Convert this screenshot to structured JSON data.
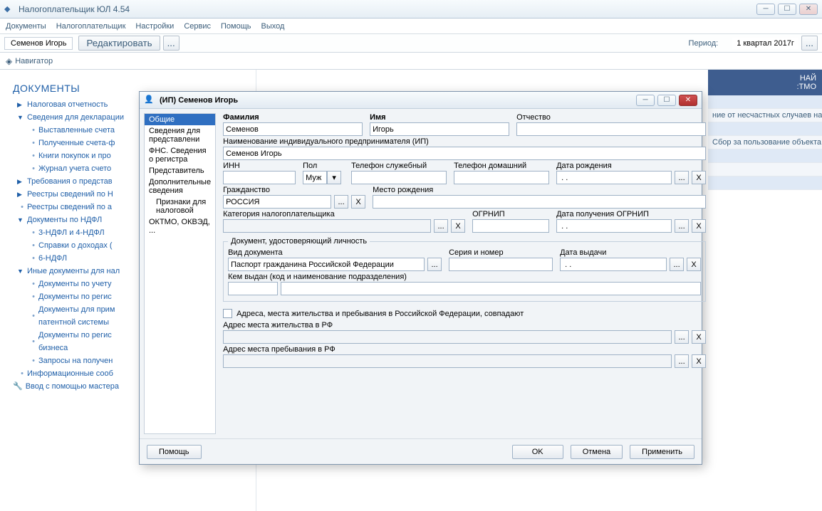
{
  "window": {
    "title": "Налогоплательщик ЮЛ 4.54",
    "menu": [
      "Документы",
      "Налогоплательщик",
      "Настройки",
      "Сервис",
      "Помощь",
      "Выход"
    ],
    "userName": "Семенов Игорь",
    "editBtn": "Редактировать",
    "moreBtn": "...",
    "periodLabel": "Период:",
    "periodValue": "1 квартал 2017г",
    "navigator": "Навигатор"
  },
  "sidebar": {
    "heading": "ДОКУМЕНТЫ",
    "items": [
      {
        "level": 1,
        "icon": "caret-collapsed",
        "text": "Налоговая отчетность"
      },
      {
        "level": 1,
        "icon": "caret-expanded",
        "text": "Сведения для декларации"
      },
      {
        "level": 2,
        "icon": "bullet",
        "text": "Выставленные счета"
      },
      {
        "level": 2,
        "icon": "bullet",
        "text": "Полученные счета-ф"
      },
      {
        "level": 2,
        "icon": "bullet",
        "text": "Книги покупок и про"
      },
      {
        "level": 2,
        "icon": "bullet",
        "text": "Журнал учета счето"
      },
      {
        "level": 1,
        "icon": "caret-collapsed",
        "text": "Требования о представ"
      },
      {
        "level": 1,
        "icon": "caret-collapsed",
        "text": "Реестры сведений по Н"
      },
      {
        "level": 1,
        "icon": "bullet",
        "text": "Реестры сведений по а"
      },
      {
        "level": 1,
        "icon": "caret-expanded",
        "text": "Документы по НДФЛ"
      },
      {
        "level": 2,
        "icon": "bullet",
        "text": "3-НДФЛ и 4-НДФЛ"
      },
      {
        "level": 2,
        "icon": "bullet",
        "text": "Справки о доходах ("
      },
      {
        "level": 2,
        "icon": "bullet",
        "text": "6-НДФЛ"
      },
      {
        "level": 1,
        "icon": "caret-expanded",
        "text": "Иные документы для нал"
      },
      {
        "level": 2,
        "icon": "bullet",
        "text": "Документы по учету"
      },
      {
        "level": 2,
        "icon": "bullet",
        "text": "Документы по регис"
      },
      {
        "level": 2,
        "icon": "bullet",
        "text": "Документы для прим\nпатентной системы"
      },
      {
        "level": 2,
        "icon": "bullet",
        "text": "Документы по регис\nбизнеса"
      },
      {
        "level": 2,
        "icon": "bullet",
        "text": "Запросы на получен"
      },
      {
        "level": 1,
        "icon": "bullet",
        "text": "Информационные сооб"
      },
      {
        "level": 0,
        "icon": "wrench",
        "text": "Ввод с помощью мастера"
      }
    ]
  },
  "rightPanel": {
    "header": "НАЙ\n:ТМО",
    "rows": [
      "",
      "ние от несчастных случаев на",
      "",
      "Сбор за пользование объекта",
      "",
      "",
      ""
    ]
  },
  "modal": {
    "title": "(ИП) Семенов Игорь",
    "leftList": [
      "Общие",
      "Сведения для представлени",
      "ФНС. Сведения о регистра",
      "Представитель",
      "Дополнительные сведения",
      "Признаки для налоговой",
      "ОКТМО, ОКВЭД, ..."
    ],
    "selectedIndex": 0,
    "labels": {
      "lastName": "Фамилия",
      "firstName": "Имя",
      "middleName": "Отчество",
      "ipName": "Наименование индивидуального предпринимателя (ИП)",
      "inn": "ИНН",
      "sex": "Пол",
      "workPhone": "Телефон служебный",
      "homePhone": "Телефон домашний",
      "birthDate": "Дата рождения",
      "citizenship": "Гражданство",
      "birthPlace": "Место рождения",
      "category": "Категория налогоплательщика",
      "ogrnip": "ОГРНИП",
      "ogrnipDate": "Дата получения ОГРНИП",
      "idGroup": "Документ, удостоверяющий личность",
      "docType": "Вид документа",
      "seriesNumber": "Серия и номер",
      "issueDate": "Дата выдачи",
      "issuedBy": "Кем выдан (код и наименование подразделения)",
      "addrSame": "Адреса, места жительства и пребывания в Российской Федерации, совпадают",
      "addrLive": "Адрес места жительства в РФ",
      "addrStay": "Адрес места пребывания в РФ"
    },
    "values": {
      "lastName": "Семенов",
      "firstName": "Игорь",
      "ipName": "Семенов Игорь",
      "sex": "Муж",
      "birthDate": " . .",
      "citizenship": "РОССИЯ",
      "docType": "Паспорт гражданина Российской Федерации",
      "ogrnipDate": " . .",
      "issueDate": " . ."
    },
    "buttons": {
      "help": "Помощь",
      "ok": "OK",
      "cancel": "Отмена",
      "apply": "Применить",
      "dots": "...",
      "x": "X",
      "dropdown": "▾"
    }
  }
}
